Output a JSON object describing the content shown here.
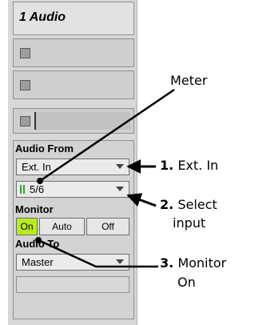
{
  "track": {
    "title": "1 Audio",
    "audio_from_label": "Audio From",
    "audio_from_value": "Ext. In",
    "input_channel": "5/6",
    "monitor_label": "Monitor",
    "monitor_buttons": [
      "On",
      "Auto",
      "Off"
    ],
    "monitor_selected": "On",
    "audio_to_label": "Audio To",
    "audio_to_value": "Master"
  },
  "callouts": {
    "meter": "Meter",
    "ext_in_num": "1.",
    "ext_in_text": "Ext. In",
    "select_num": "2.",
    "select_text_1": "Select",
    "select_text_2": "input",
    "monitor_num": "3.",
    "monitor_text_1": "Monitor",
    "monitor_text_2": "On"
  },
  "colors": {
    "monitor_on_active": "#b9ec1c",
    "meter_green": "#2bb02b",
    "panel_gray": "#d3d3d3"
  }
}
